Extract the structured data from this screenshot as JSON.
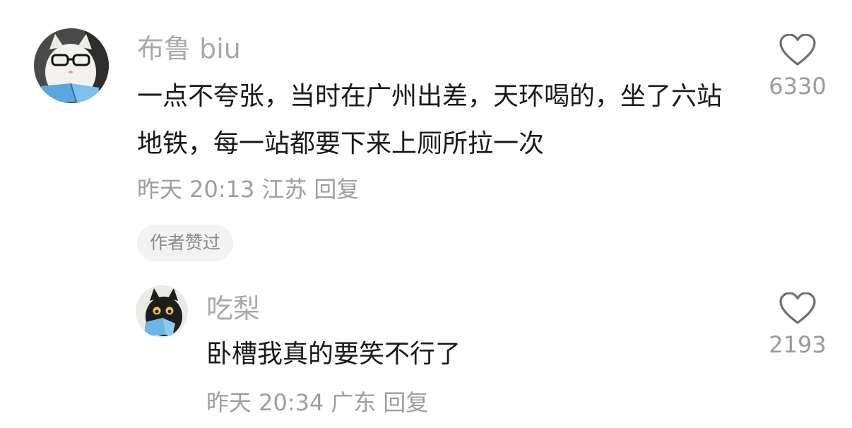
{
  "comments": [
    {
      "username": "布鲁 biu",
      "content": "一点不夸张，当时在广州出差，天环喝的，坐了六站地铁，每一站都要下来上厕所拉一次",
      "time": "昨天 20:13",
      "location": "江苏",
      "reply_label": "回复",
      "badge": "作者赞过",
      "likes": "6330",
      "avatar_icon": "cat-with-glasses-reading-icon"
    }
  ],
  "replies": [
    {
      "username": "吃梨",
      "content": "卧槽我真的要笑不行了",
      "time": "昨天 20:34",
      "location": "广东",
      "reply_label": "回复",
      "likes": "2193",
      "avatar_icon": "black-cat-reading-icon"
    }
  ],
  "colors": {
    "username": "#a9a9a9",
    "content": "#1a1a1a",
    "meta": "#9e9e9e",
    "badge_bg": "#f2f2f2"
  }
}
